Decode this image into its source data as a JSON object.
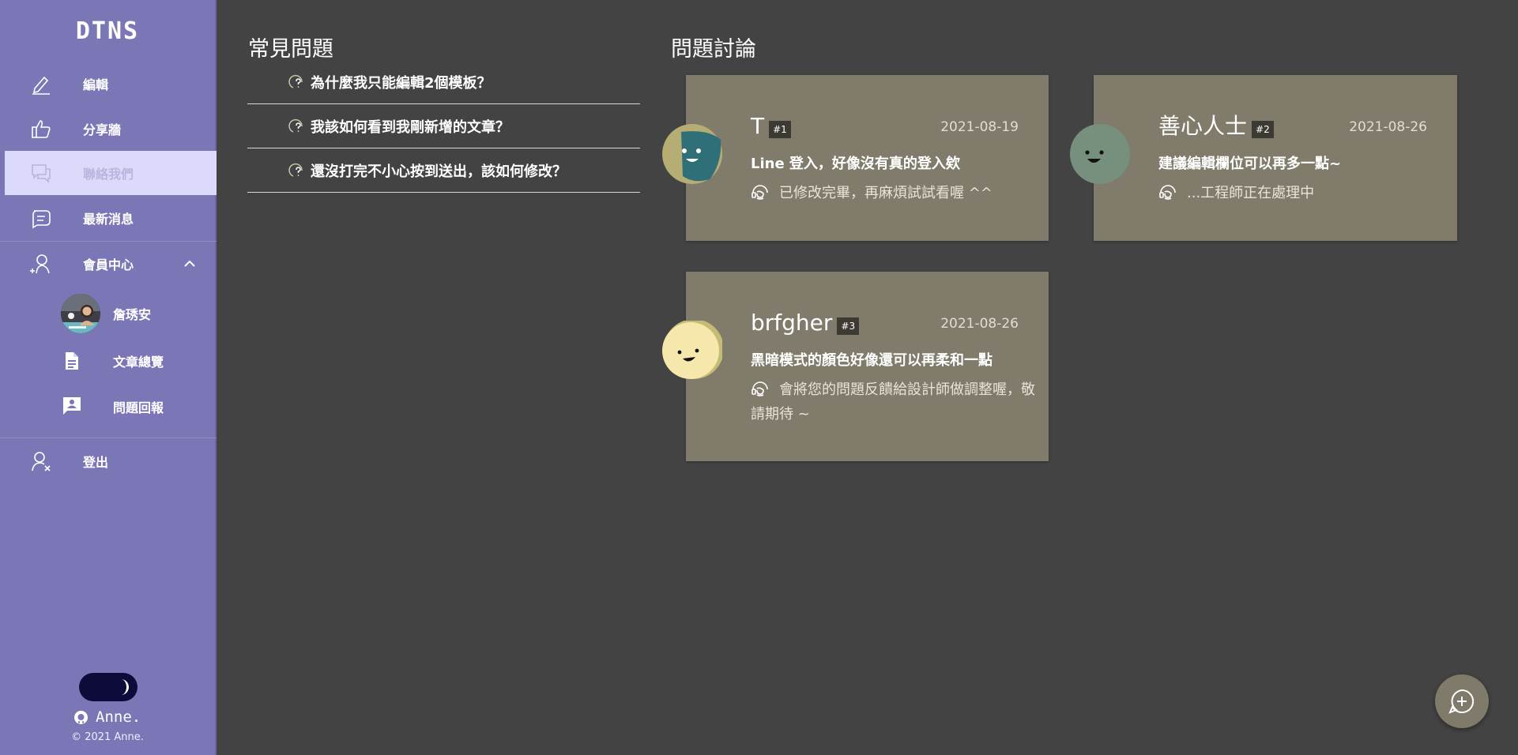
{
  "sidebar": {
    "logo": "DTNS",
    "items": [
      {
        "label": "編輯",
        "icon": "pencil-icon"
      },
      {
        "label": "分享牆",
        "icon": "thumbs-up-icon"
      },
      {
        "label": "聯絡我們",
        "icon": "chat-bubble-icon"
      },
      {
        "label": "最新消息",
        "icon": "news-bubble-icon"
      }
    ],
    "member": {
      "label": "會員中心",
      "icon": "user-add-icon"
    },
    "sub_items": [
      {
        "label": "詹琇安",
        "icon": "avatar"
      },
      {
        "label": "文章總覽",
        "icon": "document-icon"
      },
      {
        "label": "問題回報",
        "icon": "report-icon"
      }
    ],
    "logout": {
      "label": "登出",
      "icon": "user-remove-icon"
    },
    "footer_name": "Anne.",
    "copyright": "© 2021 Anne."
  },
  "faq": {
    "title": "常見問題",
    "items": [
      "為什麼我只能編輯2個模板？",
      "我該如何看到我剛新增的文章？",
      "還沒打完不小心按到送出，該如何修改？"
    ]
  },
  "discussion": {
    "title": "問題討論",
    "cards": [
      {
        "name": "T",
        "num": "#1",
        "date": "2021-08-19",
        "title": "Line 登入，好像沒有真的登入欸",
        "reply": "已修改完畢，再麻煩試試看喔 ^^"
      },
      {
        "name": "善心人士",
        "num": "#2",
        "date": "2021-08-26",
        "title": "建議編輯欄位可以再多一點~",
        "reply": "...工程師正在處理中"
      },
      {
        "name": "brfgher",
        "num": "#3",
        "date": "2021-08-26",
        "title": "黑暗模式的顏色好像還可以再柔和一點",
        "reply": "會將您的問題反饋給設計師做調整喔，敬請期待 ~"
      }
    ]
  },
  "colors": {
    "sidebar": "#7b76b6",
    "active_item": "#dcdafb",
    "background": "#434343",
    "card": "#807b6b",
    "toggle": "#0c0b3a"
  }
}
